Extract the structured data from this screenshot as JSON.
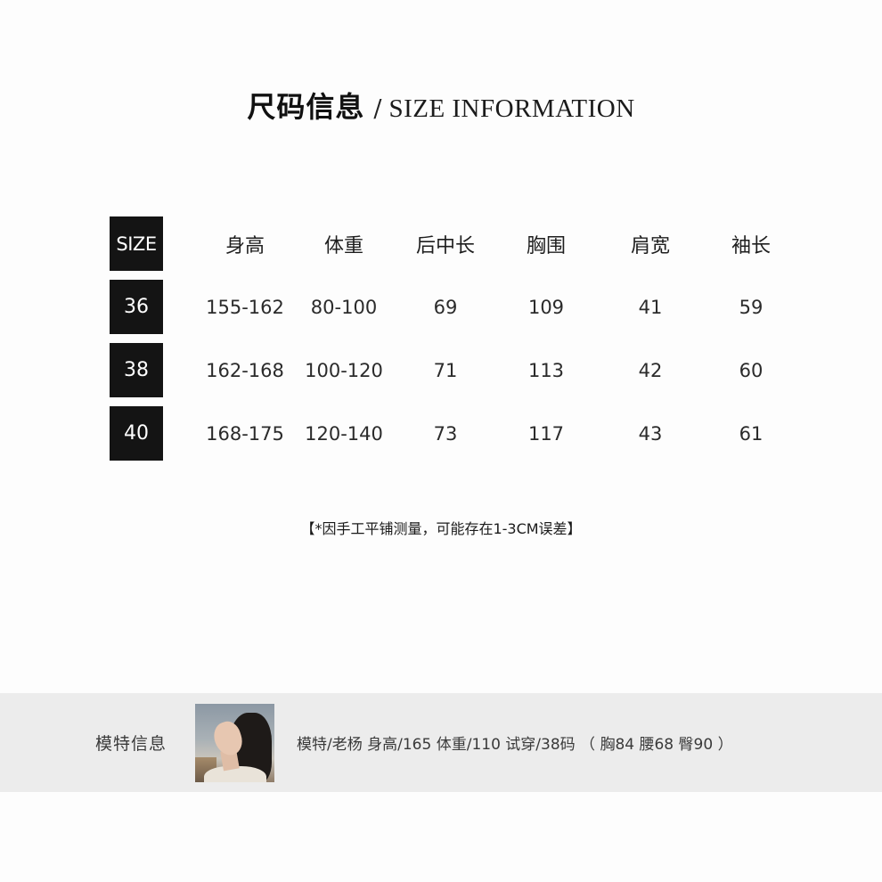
{
  "title": {
    "cn": "尺码信息",
    "separator": "/",
    "en": "SIZE INFORMATION"
  },
  "size_table": {
    "headers": [
      "SIZE",
      "身高",
      "体重",
      "后中长",
      "胸围",
      "肩宽",
      "袖长"
    ],
    "rows": [
      [
        "36",
        "155-162",
        "80-100",
        "69",
        "109",
        "41",
        "59"
      ],
      [
        "38",
        "162-168",
        "100-120",
        "71",
        "113",
        "42",
        "60"
      ],
      [
        "40",
        "168-175",
        "120-140",
        "73",
        "117",
        "43",
        "61"
      ]
    ]
  },
  "note": "【*因手工平铺测量，可能存在1-3CM误差】",
  "model": {
    "label": "模特信息",
    "info": "模特/老杨  身高/165  体重/110  试穿/38码 （ 胸84 腰68 臀90 ）"
  },
  "colors": {
    "size_cell_bg": "#141414",
    "model_band_bg": "#ececec"
  }
}
